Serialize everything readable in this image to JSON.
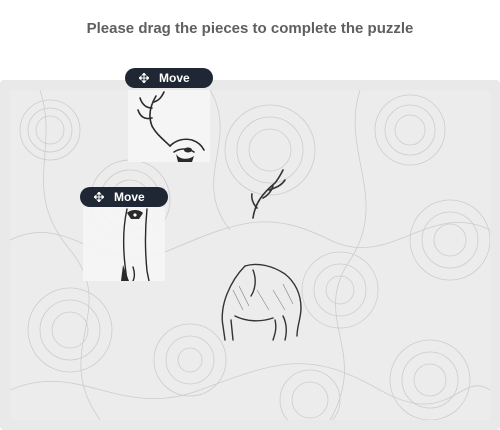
{
  "instruction": "Please drag the pieces to complete the puzzle",
  "pieces": [
    {
      "handle_label": "Move",
      "icon": "move-arrows-icon",
      "content": "deer antlers and head"
    },
    {
      "handle_label": "Move",
      "icon": "move-arrows-icon",
      "content": "deer neck and legs"
    }
  ],
  "colors": {
    "handle_bg": "#1f2735",
    "title": "#5f5f5f",
    "frame": "#e9e9e9"
  }
}
